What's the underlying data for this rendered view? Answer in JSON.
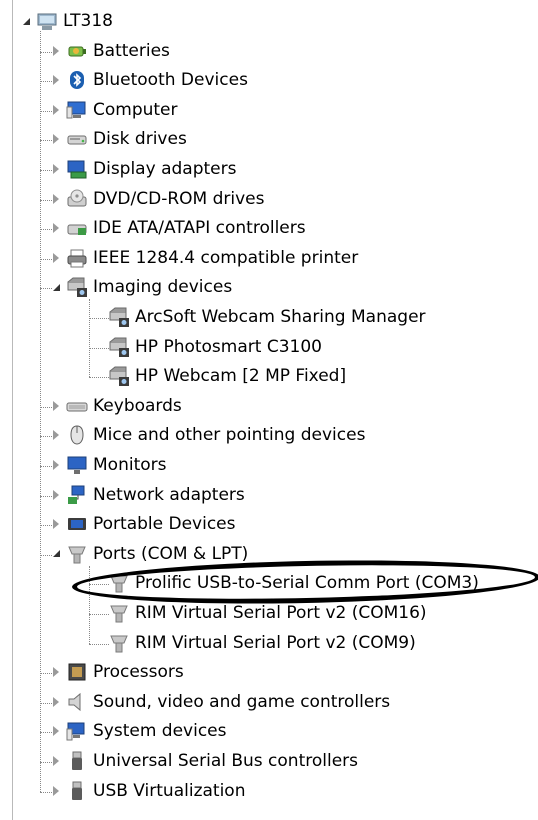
{
  "root": {
    "label": "LT318",
    "icon": "computer-icon"
  },
  "nodes": [
    {
      "label": "Batteries",
      "icon": "battery-icon",
      "expanded": false
    },
    {
      "label": "Bluetooth Devices",
      "icon": "bluetooth-icon",
      "expanded": false
    },
    {
      "label": "Computer",
      "icon": "computer-monitor-icon",
      "expanded": false
    },
    {
      "label": "Disk drives",
      "icon": "disk-drive-icon",
      "expanded": false
    },
    {
      "label": "Display adapters",
      "icon": "display-adapter-icon",
      "expanded": false
    },
    {
      "label": "DVD/CD-ROM drives",
      "icon": "dvd-drive-icon",
      "expanded": false
    },
    {
      "label": "IDE ATA/ATAPI controllers",
      "icon": "ide-controller-icon",
      "expanded": false
    },
    {
      "label": "IEEE 1284.4 compatible printer",
      "icon": "printer-icon",
      "expanded": false
    },
    {
      "label": "Imaging devices",
      "icon": "camera-icon",
      "expanded": true,
      "children": [
        {
          "label": "ArcSoft Webcam Sharing Manager",
          "icon": "camera-icon"
        },
        {
          "label": "HP Photosmart C3100",
          "icon": "camera-icon"
        },
        {
          "label": "HP Webcam [2 MP Fixed]",
          "icon": "camera-icon"
        }
      ]
    },
    {
      "label": "Keyboards",
      "icon": "keyboard-icon",
      "expanded": false
    },
    {
      "label": "Mice and other pointing devices",
      "icon": "mouse-icon",
      "expanded": false
    },
    {
      "label": "Monitors",
      "icon": "monitor-icon",
      "expanded": false
    },
    {
      "label": "Network adapters",
      "icon": "network-icon",
      "expanded": false
    },
    {
      "label": "Portable Devices",
      "icon": "portable-device-icon",
      "expanded": false
    },
    {
      "label": "Ports (COM & LPT)",
      "icon": "port-icon",
      "expanded": true,
      "children": [
        {
          "label": "Prolific USB-to-Serial Comm Port (COM3)",
          "icon": "port-icon",
          "circled": true
        },
        {
          "label": "RIM Virtual Serial Port v2 (COM16)",
          "icon": "port-icon"
        },
        {
          "label": "RIM Virtual Serial Port v2 (COM9)",
          "icon": "port-icon"
        }
      ]
    },
    {
      "label": "Processors",
      "icon": "processor-icon",
      "expanded": false
    },
    {
      "label": "Sound, video and game controllers",
      "icon": "speaker-icon",
      "expanded": false
    },
    {
      "label": "System devices",
      "icon": "system-icon",
      "expanded": false
    },
    {
      "label": "Universal Serial Bus controllers",
      "icon": "usb-icon",
      "expanded": false
    },
    {
      "label": "USB Virtualization",
      "icon": "usb-icon",
      "expanded": false
    }
  ],
  "colors": {
    "tree_line": "#888888",
    "highlight_oval": "#000000"
  }
}
